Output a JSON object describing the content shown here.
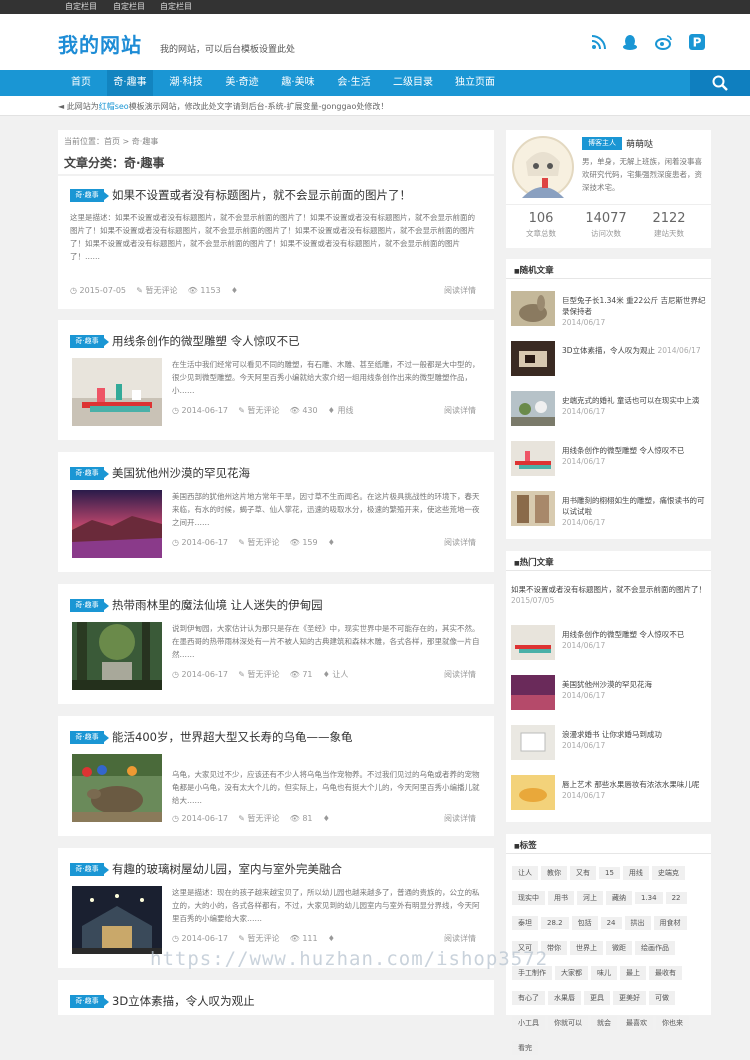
{
  "topbar": {
    "links": [
      "自定栏目",
      "自定栏目",
      "自定栏目"
    ]
  },
  "header": {
    "logo": "我的网站",
    "tagline": "我的网站，可以后台模板设置此处",
    "icons": [
      "rss-icon",
      "qq-icon",
      "weibo-icon",
      "pinterest-icon"
    ]
  },
  "nav": {
    "items": [
      "首页",
      "奇·趣事",
      "潮·科技",
      "美·奇迹",
      "趣·美味",
      "会·生活",
      "二级目录",
      "独立页面"
    ],
    "search_icon": "search-icon"
  },
  "notice": {
    "prefix": "此网站为",
    "highlight": "红帽seo",
    "suffix": "模板演示网站，修改此处文字请到后台-系统-扩展变量-gonggao处修改！"
  },
  "crumbs": {
    "label": "当前位置：",
    "home": "首页",
    "sep": " > ",
    "current": "奇·趣事",
    "category_title": "文章分类：奇·趣事"
  },
  "posts": [
    {
      "tag": "奇·趣事",
      "title": "如果不设置或者没有标题图片，就不会显示前面的图片了！",
      "excerpt": "这里是描述：如果不设置或者没有标题图片，就不会显示前面的图片了！如果不设置或者没有标题图片，就不会显示前面的图片了！如果不设置或者没有标题图片，就不会显示前面的图片了！如果不设置或者没有标题图片，就不会显示前面的图片了！如果不设置或者没有标题图片，就不会显示前面的图片了！如果不设置或者没有标题图片，就不会显示前面的图片了！……",
      "date": "2015-07-05",
      "comments": "暂无评论",
      "views": "1153",
      "tagtxt": "",
      "more": "阅读详情"
    },
    {
      "tag": "奇·趣事",
      "title": "用线条创作的微型雕塑 令人惊叹不已",
      "excerpt": "在生活中我们经常可以看见不同的雕塑，有石雕、木雕、甚至纸雕，不过一般都是大中型的，很少见到微型雕塑。今天阿里百秀小编就给大家介绍一组用线条创作出来的微型雕塑作品，小……",
      "date": "2014-06-17",
      "comments": "暂无评论",
      "views": "430",
      "tagtxt": "用线",
      "more": "阅读详情"
    },
    {
      "tag": "奇·趣事",
      "title": "美国犹他州沙漠的罕见花海",
      "excerpt": "美国西部的犹他州这片地方常年干旱，因寸草不生而闻名。在这片极具挑战性的环境下，春天来临，有水的时候，蝎子草、仙人掌花，迅速的吸取水分，极速的繁殖开来，使这些荒地一夜之间开……",
      "date": "2014-06-17",
      "comments": "暂无评论",
      "views": "159",
      "tagtxt": "",
      "more": "阅读详情"
    },
    {
      "tag": "奇·趣事",
      "title": "热带雨林里的魔法仙境 让人迷失的伊甸园",
      "excerpt": "说到伊甸园，大家估计认为那只是存在《圣经》中，现实世界中是不可能存在的，其实不然。在墨西哥的热带雨林深处有一片不被人知的古典建筑和森林木雕，各式各样，那里就像一片自然……",
      "date": "2014-06-17",
      "comments": "暂无评论",
      "views": "71",
      "tagtxt": "让人",
      "more": "阅读详情"
    },
    {
      "tag": "奇·趣事",
      "title": "能活400岁，世界超大型又长寿的乌龟——象龟",
      "excerpt": "乌龟，大家见过不少，应该还有不少人将乌龟当作宠物养。不过我们见过的乌龟或者养的宠物龟都是小乌龟，没有太大个儿的，但实际上，乌龟也有挺大个儿的，今天阿里百秀小编播儿就给大……",
      "date": "2014-06-17",
      "comments": "暂无评论",
      "views": "81",
      "tagtxt": "",
      "more": "阅读详情"
    },
    {
      "tag": "奇·趣事",
      "title": "有趣的玻璃树屋幼儿园，室内与室外完美融合",
      "excerpt": "这里是描述：现在的孩子越来越宝贝了，所以幼儿园也越来越多了，普通的贵族的，公立的私立的，大的小的，各式各样都有，不过，大家见到的幼儿园室内与室外有明显分界线，今天阿里百秀的小编要给大家……",
      "date": "2014-06-17",
      "comments": "暂无评论",
      "views": "111",
      "tagtxt": "",
      "more": "阅读详情"
    },
    {
      "tag": "奇·趣事",
      "title": "3D立体素描，令人叹为观止"
    }
  ],
  "author": {
    "badge": "博客主人",
    "name": "萌萌哒",
    "bio": "男，单身，无解上班族，闲着没事喜欢研究代码，宅集强烈深度患者，资深技术宅。",
    "stats": [
      {
        "num": "106",
        "label": "文章总数"
      },
      {
        "num": "14077",
        "label": "访问次数"
      },
      {
        "num": "2122",
        "label": "建站天数"
      }
    ]
  },
  "random": {
    "title": "随机文章",
    "items": [
      {
        "t": "巨型兔子长1.34米 重22公斤 吉尼斯世界纪录保持者",
        "d": "2014/06/17"
      },
      {
        "t": "3D立体素描，令人叹为观止",
        "d": "2014/06/17"
      },
      {
        "t": "史端克式的婚礼 童话也可以在现实中上演",
        "d": "2014/06/17"
      },
      {
        "t": "用线条创作的微型雕塑 令人惊叹不已",
        "d": "2014/06/17"
      },
      {
        "t": "用书雕刻的栩栩如生的雕塑，痛恨读书的可以试试啦",
        "d": "2014/06/17"
      }
    ]
  },
  "hot": {
    "title": "热门文章",
    "first": {
      "t": "如果不设置或者没有标题图片，就不会显示前面的图片了！",
      "d": "2015/07/05"
    },
    "items": [
      {
        "t": "用线条创作的微型雕塑 令人惊叹不已",
        "d": "2014/06/17"
      },
      {
        "t": "美国犹他州沙漠的罕见花海",
        "d": "2014/06/17"
      },
      {
        "t": "浪漫求婚书 让你求婚马到成功",
        "d": "2014/06/17"
      },
      {
        "t": "唇上艺术 那些水果唇妆有浓浓水果味儿呢",
        "d": "2014/06/17"
      }
    ]
  },
  "tagcloud": {
    "title": "标签",
    "tags": [
      "让人",
      "教你",
      "又有",
      "15",
      "用线",
      "史端克",
      "现实中",
      "用书",
      "河上",
      "藏纳",
      "1.34",
      "22",
      "泰坦",
      "28.2",
      "包括",
      "24",
      "拱出",
      "用食材",
      "又可",
      "带你",
      "世界上",
      "微距",
      "绘画作品",
      "手工制作",
      "大家都",
      "味儿",
      "最上",
      "最收有",
      "有心了",
      "水果唇",
      "更具",
      "更美好",
      "可做",
      "小工具",
      "你就可以",
      "就会",
      "最喜欢",
      "你也来",
      "看完"
    ]
  },
  "watermark": "https://www.huzhan.com/ishop3572"
}
